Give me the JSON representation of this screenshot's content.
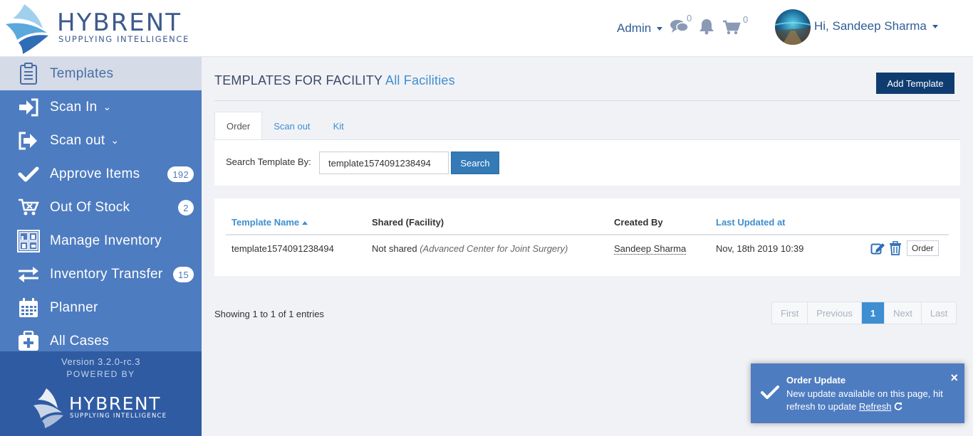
{
  "header": {
    "logo_title": "HYBRENT",
    "logo_subtitle": "SUPPLYING INTELLIGENCE",
    "admin_label": "Admin",
    "messages_count": "0",
    "cart_count": "0",
    "greeting": "Hi, Sandeep Sharma"
  },
  "sidebar": {
    "items": [
      {
        "label": "Templates",
        "icon": "clipboard-icon",
        "active": true
      },
      {
        "label": "Scan In",
        "icon": "sign-in-icon",
        "chevron": "⌄"
      },
      {
        "label": "Scan out",
        "icon": "sign-out-icon",
        "chevron": "⌄"
      },
      {
        "label": "Approve Items",
        "icon": "check-icon",
        "badge": "192"
      },
      {
        "label": "Out Of Stock",
        "icon": "cart-icon",
        "badge": "2"
      },
      {
        "label": "Manage Inventory",
        "icon": "inventory-icon"
      },
      {
        "label": "Inventory Transfer",
        "icon": "transfer-icon",
        "badge": "15"
      },
      {
        "label": "Planner",
        "icon": "calendar-icon"
      },
      {
        "label": "All Cases",
        "icon": "medkit-icon"
      }
    ],
    "version": "Version 3.2.0-rc.3",
    "powered_by": "POWERED BY",
    "footer_logo_title": "HYBRENT",
    "footer_logo_subtitle": "SUPPLYING INTELLIGENCE"
  },
  "page": {
    "title": "TEMPLATES FOR FACILITY",
    "facility": "All Facilities",
    "add_template_label": "Add Template"
  },
  "tabs": [
    {
      "label": "Order",
      "active": true
    },
    {
      "label": "Scan out"
    },
    {
      "label": "Kit"
    }
  ],
  "search": {
    "label": "Search Template By:",
    "value": "template1574091238494",
    "button_label": "Search"
  },
  "table": {
    "columns": [
      "Template Name",
      "Shared (Facility)",
      "Created By",
      "Last Updated at"
    ],
    "rows": [
      {
        "template_name": "template1574091238494",
        "shared": "Not shared",
        "shared_facility": "(Advanced Center for Joint Surgery)",
        "created_by": "Sandeep Sharma",
        "last_updated": "Nov, 18th 2019 10:39",
        "order_label": "Order"
      }
    ]
  },
  "pagination": {
    "showing": "Showing 1 to 1 of 1 entries",
    "first": "First",
    "previous": "Previous",
    "current": "1",
    "next": "Next",
    "last": "Last"
  },
  "toast": {
    "title": "Order Update",
    "message": "New update available on this page, hit refresh to update",
    "refresh_label": "Refresh",
    "close": "×"
  },
  "colors": {
    "sidebar": "#4e7cc0",
    "sidebar_footer": "#2f5ba3",
    "accent": "#3d8fd1",
    "primary_button": "#337ab7",
    "add_button": "#0f3c70"
  }
}
